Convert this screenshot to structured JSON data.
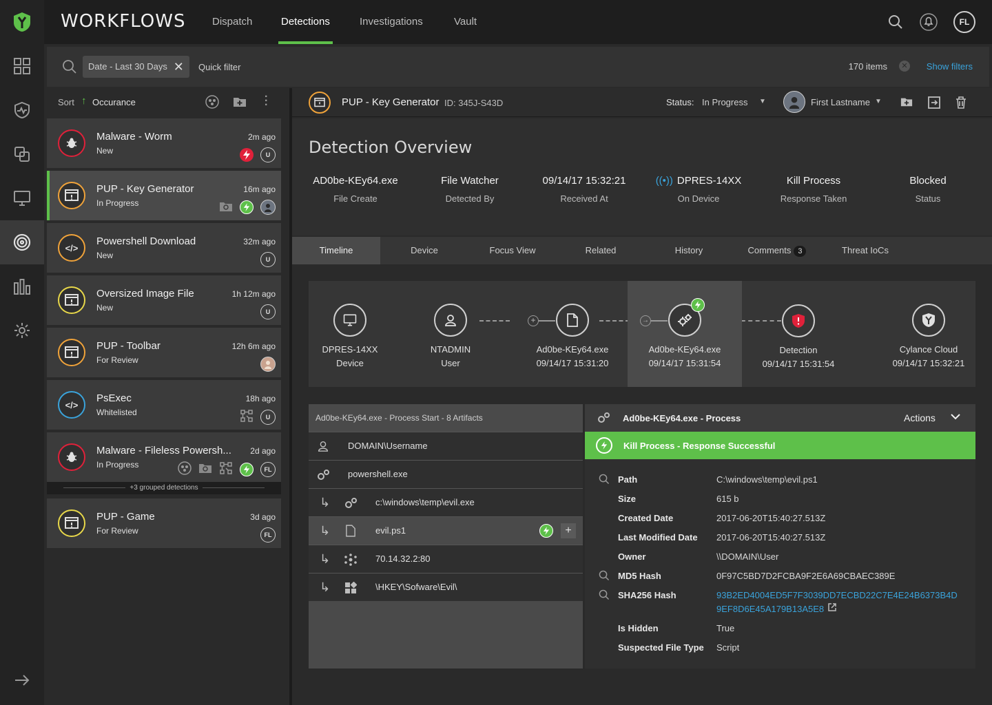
{
  "app": {
    "title": "WORKFLOWS",
    "user_initials": "FL"
  },
  "nav_tabs": [
    "Dispatch",
    "Detections",
    "Investigations",
    "Vault"
  ],
  "filter": {
    "chip": "Date - Last 30 Days",
    "quick_filter_placeholder": "Quick filter",
    "item_count": "170 items",
    "show_filters": "Show filters"
  },
  "sort": {
    "label": "Sort",
    "value": "Occurance"
  },
  "detections": [
    {
      "title": "Malware - Worm",
      "status": "New",
      "time": "2m ago",
      "avatar": "U"
    },
    {
      "title": "PUP - Key Generator",
      "status": "In Progress",
      "time": "16m ago"
    },
    {
      "title": "Powershell Download",
      "status": "New",
      "time": "32m ago",
      "avatar": "U"
    },
    {
      "title": "Oversized Image File",
      "status": "New",
      "time": "1h 12m ago",
      "avatar": "U"
    },
    {
      "title": "PUP - Toolbar",
      "status": "For Review",
      "time": "12h 6m ago"
    },
    {
      "title": "PsExec",
      "status": "Whitelisted",
      "time": "18h ago",
      "avatar": "U"
    },
    {
      "title": "Malware - Fileless Powersh...",
      "status": "In Progress",
      "time": "2d ago",
      "avatar": "FL",
      "grouped": "+3 grouped detections"
    },
    {
      "title": "PUP - Game",
      "status": "For Review",
      "time": "3d ago",
      "avatar": "FL"
    }
  ],
  "detail": {
    "title": "PUP - Key Generator",
    "id": "ID: 345J-S43D",
    "status_label": "Status:",
    "status_value": "In Progress",
    "assignee": "First Lastname",
    "overview_title": "Detection Overview",
    "overview": [
      {
        "value": "AD0be-KEy64.exe",
        "label": "File Create"
      },
      {
        "value": "File Watcher",
        "label": "Detected By"
      },
      {
        "value": "09/14/17 15:32:21",
        "label": "Received At"
      },
      {
        "value": "DPRES-14XX",
        "label": "On Device"
      },
      {
        "value": "Kill Process",
        "label": "Response Taken"
      },
      {
        "value": "Blocked",
        "label": "Status"
      }
    ],
    "tabs": [
      "Timeline",
      "Device",
      "Focus View",
      "Related",
      "History",
      "Comments",
      "Threat IoCs"
    ],
    "comments_count": "3"
  },
  "timeline": [
    {
      "l1": "DPRES-14XX",
      "l2": "Device"
    },
    {
      "l1": "NTADMIN",
      "l2": "User"
    },
    {
      "l1": "Ad0be-KEy64.exe",
      "l2": "09/14/17 15:31:20"
    },
    {
      "l1": "Ad0be-KEy64.exe",
      "l2": "09/14/17 15:31:54"
    },
    {
      "l1": "Detection",
      "l2": "09/14/17 15:31:54"
    },
    {
      "l1": "Cylance Cloud",
      "l2": "09/14/17 15:32:21"
    }
  ],
  "artifacts": {
    "header": "Ad0be-KEy64.exe - Process Start - 8 Artifacts",
    "rows": [
      "DOMAIN\\Username",
      "powershell.exe",
      "c:\\windows\\temp\\evil.exe",
      "evil.ps1",
      "70.14.32.2:80",
      "\\HKEY\\Sofware\\Evil\\"
    ]
  },
  "process": {
    "title": "Ad0be-KEy64.exe - Process",
    "actions": "Actions",
    "success": "Kill Process - Response Successful",
    "props": [
      {
        "k": "Path",
        "v": "C:\\windows\\temp\\evil.ps1"
      },
      {
        "k": "Size",
        "v": "615 b"
      },
      {
        "k": "Created Date",
        "v": "2017-06-20T15:40:27.513Z"
      },
      {
        "k": "Last Modified Date",
        "v": "2017-06-20T15:40:27.513Z"
      },
      {
        "k": "Owner",
        "v": "\\\\DOMAIN\\User"
      },
      {
        "k": "MD5 Hash",
        "v": "0F97C5BD7D2FCBA9F2E6A69CBAEC389E"
      },
      {
        "k": "SHA256 Hash",
        "v": "93B2ED4004ED5F7F3039DD7ECBD22C7E4E24B6373B4D",
        "v2": "9EF8D6E45A179B13A5E8"
      },
      {
        "k": "Is Hidden",
        "v": "True"
      },
      {
        "k": "Suspected File Type",
        "v": "Script"
      }
    ]
  },
  "colors": {
    "accent": "#5ec04a",
    "link": "#3aa3db",
    "danger": "#e0213a",
    "warning": "#f0a33a",
    "review": "#e8d84a",
    "info": "#3aa3db"
  }
}
